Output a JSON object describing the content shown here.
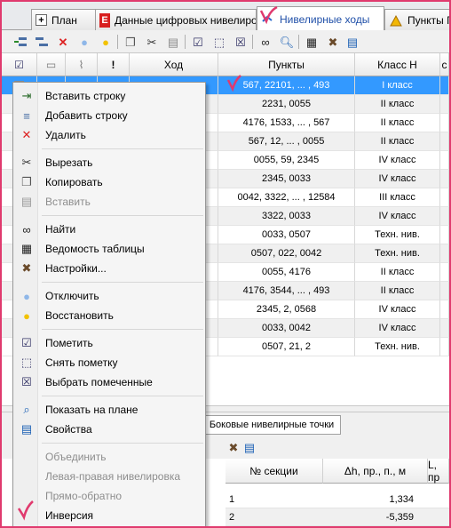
{
  "tabs": [
    {
      "label": "План",
      "icon": "plus-square-icon"
    },
    {
      "label": "Данные цифровых нивелиров",
      "icon": "digital-level-icon"
    },
    {
      "label": "Нивелирные ходы",
      "icon": "leveling-runs-icon",
      "active": true
    },
    {
      "label": "Пункты Г",
      "icon": "triangle-points-icon"
    }
  ],
  "grid": {
    "columns": [
      "",
      "",
      "",
      "!",
      "Ход",
      "Пункты",
      "Класс Н",
      "с"
    ],
    "rows": [
      {
        "points": "567, 22101, ... , 493",
        "class": "I класс",
        "selected": true
      },
      {
        "points": "2231, 0055",
        "class": "II класс"
      },
      {
        "points": "4176, 1533, ... , 567",
        "class": "II класс"
      },
      {
        "points": "567, 12, ... , 0055",
        "class": "II класс"
      },
      {
        "points": "0055, 59, 2345",
        "class": "IV класс"
      },
      {
        "points": "2345, 0033",
        "class": "IV класс"
      },
      {
        "points": "0042, 3322, ... , 12584",
        "class": "III класс"
      },
      {
        "points": "3322, 0033",
        "class": "IV класс"
      },
      {
        "points": "0033, 0507",
        "class": "Техн. нив."
      },
      {
        "points": "0507, 022, 0042",
        "class": "Техн. нив."
      },
      {
        "points": "0055, 4176",
        "class": "II класс"
      },
      {
        "points": "4176, 3544, ... , 493",
        "class": "II класс"
      },
      {
        "points": "2345, 2, 0568",
        "class": "IV класс"
      },
      {
        "points": "0033, 0042",
        "class": "IV класс"
      },
      {
        "points": "0507, 21, 2",
        "class": "Техн. нив."
      }
    ]
  },
  "bottom": {
    "tab_label": "Боковые нивелирные точки",
    "columns": [
      "№ секции",
      "Δh, пр., п., м",
      "L, пр"
    ],
    "rows": [
      {
        "section": "1",
        "dh": "1,334"
      },
      {
        "section": "2",
        "dh": "-5,359"
      }
    ]
  },
  "context_menu": {
    "items": [
      {
        "label": "Вставить строку",
        "icon": "insert-row-icon",
        "enabled": true
      },
      {
        "label": "Добавить строку",
        "icon": "add-row-icon",
        "enabled": true
      },
      {
        "label": "Удалить",
        "icon": "delete-x-icon",
        "enabled": true
      },
      {
        "label": "Вырезать",
        "icon": "scissors-icon",
        "enabled": true
      },
      {
        "label": "Копировать",
        "icon": "copy-icon",
        "enabled": true
      },
      {
        "label": "Вставить",
        "icon": "paste-icon",
        "enabled": false
      },
      {
        "label": "Найти",
        "icon": "binoculars-icon",
        "enabled": true
      },
      {
        "label": "Ведомость таблицы",
        "icon": "table-report-icon",
        "enabled": true
      },
      {
        "label": "Настройки...",
        "icon": "tools-icon",
        "enabled": true
      },
      {
        "label": "Отключить",
        "icon": "bulb-off-icon",
        "enabled": true
      },
      {
        "label": "Восстановить",
        "icon": "bulb-on-icon",
        "enabled": true
      },
      {
        "label": "Пометить",
        "icon": "mark-icon",
        "enabled": true
      },
      {
        "label": "Снять пометку",
        "icon": "unmark-icon",
        "enabled": true
      },
      {
        "label": "Выбрать помеченные",
        "icon": "select-marked-icon",
        "enabled": true
      },
      {
        "label": "Показать на плане",
        "icon": "show-on-plan-icon",
        "enabled": true
      },
      {
        "label": "Свойства",
        "icon": "properties-icon",
        "enabled": true
      },
      {
        "label": "Объединить",
        "enabled": false
      },
      {
        "label": "Левая-правая нивелировка",
        "enabled": false
      },
      {
        "label": "Прямо-обратно",
        "enabled": false
      },
      {
        "label": "Инверсия",
        "enabled": true
      }
    ]
  },
  "colors": {
    "selection": "#3399ff",
    "annotation": "#e03a6e"
  }
}
